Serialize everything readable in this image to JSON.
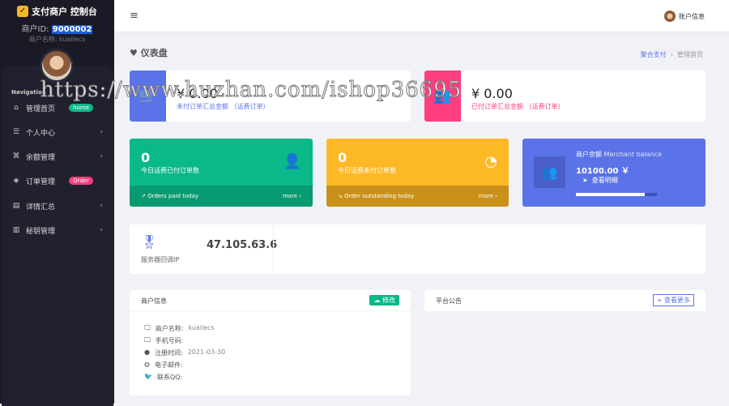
{
  "sidebar": {
    "brand": "支付商户 控制台",
    "merchant_id_label": "商户ID:",
    "merchant_id": "9000002",
    "merchant_name": "商户名称: kuailecs",
    "nav_label": "Navigation",
    "items": [
      {
        "label": "管理首页",
        "icon": "home-icon",
        "badge": "home"
      },
      {
        "label": "个人中心",
        "icon": "list-icon"
      },
      {
        "label": "余额管理",
        "icon": "command-icon"
      },
      {
        "label": "订单管理",
        "icon": "layers-icon",
        "badge": "Order"
      },
      {
        "label": "详情汇总",
        "icon": "document-icon"
      },
      {
        "label": "秘钥管理",
        "icon": "map-icon"
      }
    ]
  },
  "header": {
    "account": "账户信息"
  },
  "page": {
    "title": "仪表盘",
    "breadcrumb": [
      "聚合支付",
      "管理首页"
    ]
  },
  "summary": [
    {
      "amount": "¥ 0.00",
      "label": "未付订单汇总金额 （话费订单）",
      "color": "#5b73e8"
    },
    {
      "amount": "¥ 0.00",
      "label": "已付订单汇总金额 （话费订单）",
      "color": "#ff3d7f"
    }
  ],
  "stats": [
    {
      "value": "0",
      "label": "今日话费已付订单数",
      "footer": "Orders paid today",
      "more": "more",
      "color": "#0ab988"
    },
    {
      "value": "0",
      "label": "今日话费未付订单数",
      "footer": "Order outstanding today",
      "more": "more",
      "color": "#fdb826"
    }
  ],
  "balance": {
    "title": "商户余额",
    "title_en": "Merchant balance",
    "amount": "10100.00 ￥",
    "link": "查看明细",
    "progress_percent": 85
  },
  "server": {
    "ip": "47.105.63.6",
    "label": "服务器回调IP"
  },
  "merchant_info": {
    "title": "商户信息",
    "edit": "修改",
    "rows": [
      {
        "label": "商户名称:",
        "value": "kuailecs"
      },
      {
        "label": "手机号码:",
        "value": ""
      },
      {
        "label": "注册时间:",
        "value": "2021-03-30"
      },
      {
        "label": "电子邮件:",
        "value": ""
      },
      {
        "label": "联系QQ:",
        "value": ""
      }
    ]
  },
  "notice": {
    "title": "平台公告",
    "more": "+ 查看更多"
  },
  "watermark": "https://www.huzhan.com/ishop36695"
}
